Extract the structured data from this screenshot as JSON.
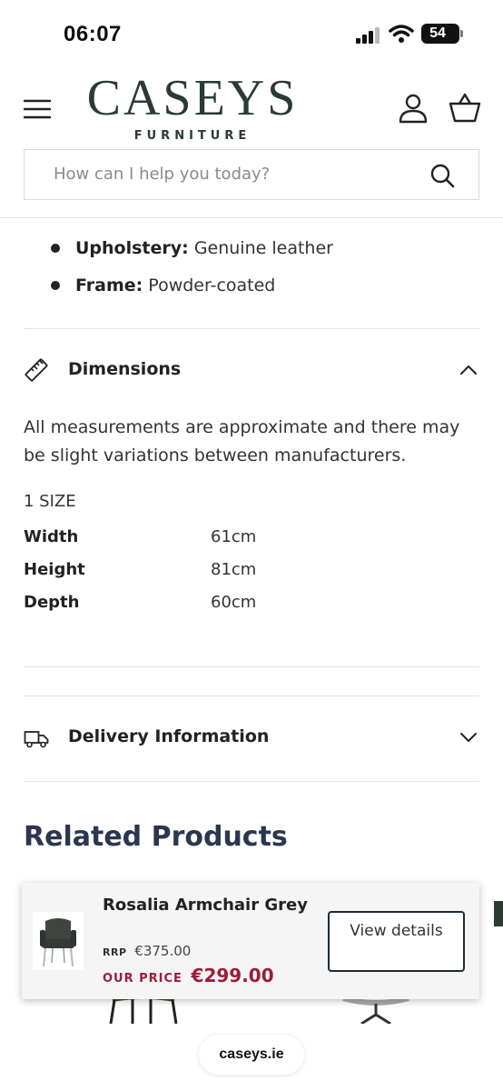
{
  "status_bar": {
    "time": "06:07",
    "battery": "54"
  },
  "header": {
    "logo_main": "CASEYS",
    "logo_sub": "FURNITURE",
    "search_placeholder": "How can I help you today?"
  },
  "specs": [
    {
      "label": "Upholstery:",
      "value": "Genuine leather"
    },
    {
      "label": "Frame:",
      "value": "Powder-coated"
    }
  ],
  "dimensions": {
    "title": "Dimensions",
    "note": "All measurements are approximate and there may be slight variations between manufacturers.",
    "size_label": "1 SIZE",
    "rows": [
      {
        "label": "Width",
        "value": "61cm"
      },
      {
        "label": "Height",
        "value": "81cm"
      },
      {
        "label": "Depth",
        "value": "60cm"
      }
    ]
  },
  "delivery": {
    "title": "Delivery Information"
  },
  "related": {
    "title": "Related Products"
  },
  "sticky_product": {
    "name": "Rosalia Armchair Grey",
    "rrp_label": "RRP",
    "rrp_price": "€375.00",
    "our_price_label": "OUR PRICE",
    "our_price": "€299.00",
    "button_label": "View details"
  },
  "url": "caseys.ie",
  "colors": {
    "brand": "#2a3b33",
    "price": "#9b1d3a",
    "heading": "#2b3650"
  }
}
